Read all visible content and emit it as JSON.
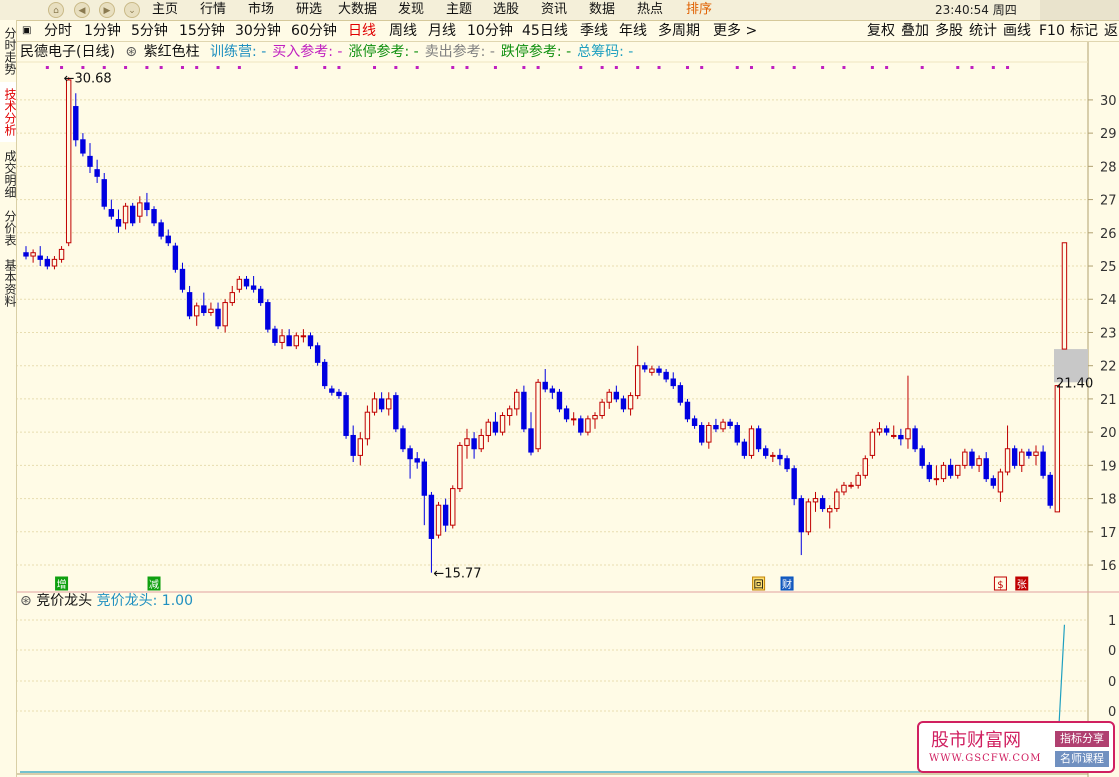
{
  "menu": [
    "主页",
    "行情",
    "市场",
    "研选",
    "大数据",
    "发现",
    "主题",
    "选股",
    "资讯",
    "数据",
    "热点",
    "排序"
  ],
  "menu_active": "排序",
  "clock": "23:40:54 周四",
  "periods": [
    "分时",
    "1分钟",
    "5分钟",
    "15分钟",
    "30分钟",
    "60分钟",
    "日线",
    "周线",
    "月线",
    "10分钟",
    "45日线",
    "季线",
    "年线",
    "多周期",
    "更多 >"
  ],
  "period_active": "日线",
  "right_tools": [
    "复权",
    "叠加",
    "多股",
    "统计",
    "画线",
    "F10",
    "标记",
    "返"
  ],
  "sidebar": [
    "分时走势",
    "技术分析",
    "成交明细",
    "分价表",
    "基本资料"
  ],
  "sidebar_active": "技术分析",
  "info": {
    "stock": "民德电子(日线)",
    "indicator": "紫红色柱",
    "items": [
      {
        "text": "训练营: -",
        "color": "#2090c0"
      },
      {
        "text": "买入参考: -",
        "color": "#c020c0"
      },
      {
        "text": "涨停参考: -",
        "color": "#109010"
      },
      {
        "text": "卖出参考: -",
        "color": "#808080"
      },
      {
        "text": "跌停参考: -",
        "color": "#109010"
      },
      {
        "text": "总筹码: -",
        "color": "#20a0c0"
      }
    ]
  },
  "subinfo": {
    "name": "竞价龙头",
    "label": "竞价龙头: 1.00",
    "color": "#2090c0"
  },
  "colors": {
    "up": "#c00000",
    "down": "#0000e0",
    "grid": "#e8ddb0",
    "axis": "#b0a070",
    "dots": "#c020c0",
    "subline": "#20a0c0"
  },
  "chart_data": {
    "type": "candlestick",
    "ylim": [
      15.7,
      30.9
    ],
    "yticks": [
      16,
      17,
      18,
      19,
      20,
      21,
      22,
      23,
      24,
      25,
      26,
      27,
      28,
      29,
      30
    ],
    "annotations": [
      {
        "text": "30.68",
        "value": 30.68,
        "index": 5
      },
      {
        "text": "15.77",
        "value": 15.77,
        "index": 57
      },
      {
        "text": "21.40",
        "value": 21.4,
        "index": 138
      }
    ],
    "candles": [
      [
        25.4,
        25.6,
        25.2,
        25.3
      ],
      [
        25.3,
        25.5,
        25.1,
        25.4
      ],
      [
        25.3,
        25.6,
        25.0,
        25.2
      ],
      [
        25.2,
        25.3,
        24.9,
        25.0
      ],
      [
        25.0,
        25.3,
        24.9,
        25.2
      ],
      [
        25.2,
        25.6,
        25.1,
        25.5
      ],
      [
        25.7,
        30.68,
        25.6,
        30.6
      ],
      [
        29.8,
        30.2,
        28.6,
        28.8
      ],
      [
        28.8,
        29.0,
        28.3,
        28.4
      ],
      [
        28.3,
        28.7,
        27.8,
        28.0
      ],
      [
        27.9,
        28.2,
        27.5,
        27.7
      ],
      [
        27.6,
        27.8,
        26.7,
        26.8
      ],
      [
        26.7,
        27.0,
        26.4,
        26.5
      ],
      [
        26.4,
        26.7,
        26.0,
        26.2
      ],
      [
        26.3,
        26.9,
        26.1,
        26.8
      ],
      [
        26.8,
        26.9,
        26.2,
        26.3
      ],
      [
        26.5,
        27.1,
        26.3,
        26.9
      ],
      [
        26.9,
        27.2,
        26.5,
        26.7
      ],
      [
        26.7,
        26.8,
        26.2,
        26.3
      ],
      [
        26.3,
        26.4,
        25.8,
        25.9
      ],
      [
        25.9,
        26.1,
        25.6,
        25.7
      ],
      [
        25.6,
        25.7,
        24.8,
        24.9
      ],
      [
        24.9,
        25.1,
        24.2,
        24.3
      ],
      [
        24.2,
        24.4,
        23.4,
        23.5
      ],
      [
        23.5,
        23.9,
        23.2,
        23.8
      ],
      [
        23.8,
        24.2,
        23.5,
        23.6
      ],
      [
        23.6,
        23.9,
        23.5,
        23.7
      ],
      [
        23.7,
        23.9,
        23.1,
        23.2
      ],
      [
        23.2,
        24.0,
        23.0,
        23.9
      ],
      [
        23.9,
        24.4,
        23.8,
        24.2
      ],
      [
        24.3,
        24.7,
        24.2,
        24.6
      ],
      [
        24.6,
        24.7,
        24.3,
        24.4
      ],
      [
        24.4,
        24.7,
        24.2,
        24.3
      ],
      [
        24.3,
        24.4,
        23.8,
        23.9
      ],
      [
        23.9,
        24.0,
        23.0,
        23.1
      ],
      [
        23.1,
        23.2,
        22.6,
        22.7
      ],
      [
        22.7,
        23.1,
        22.5,
        22.9
      ],
      [
        22.9,
        23.1,
        22.6,
        22.6
      ],
      [
        22.6,
        23.0,
        22.5,
        22.9
      ],
      [
        22.9,
        23.1,
        22.7,
        22.9
      ],
      [
        22.9,
        23.0,
        22.5,
        22.6
      ],
      [
        22.6,
        22.7,
        22.0,
        22.1
      ],
      [
        22.1,
        22.2,
        21.3,
        21.4
      ],
      [
        21.3,
        21.4,
        21.1,
        21.2
      ],
      [
        21.2,
        21.3,
        21.0,
        21.1
      ],
      [
        21.1,
        21.2,
        19.8,
        19.9
      ],
      [
        19.9,
        20.2,
        19.1,
        19.3
      ],
      [
        19.3,
        20.0,
        19.0,
        19.8
      ],
      [
        19.8,
        20.8,
        19.6,
        20.6
      ],
      [
        20.6,
        21.2,
        20.5,
        21.0
      ],
      [
        21.0,
        21.2,
        20.6,
        20.7
      ],
      [
        20.7,
        21.2,
        20.5,
        21.0
      ],
      [
        21.1,
        21.2,
        20.0,
        20.1
      ],
      [
        20.1,
        20.2,
        19.4,
        19.5
      ],
      [
        19.5,
        19.6,
        18.6,
        19.2
      ],
      [
        19.2,
        19.4,
        18.9,
        19.1
      ],
      [
        19.1,
        19.2,
        17.2,
        18.1
      ],
      [
        18.1,
        18.2,
        15.77,
        16.8
      ],
      [
        16.9,
        17.9,
        16.8,
        17.8
      ],
      [
        17.8,
        18.0,
        17.0,
        17.2
      ],
      [
        17.2,
        18.4,
        17.1,
        18.3
      ],
      [
        18.3,
        19.7,
        18.2,
        19.6
      ],
      [
        19.6,
        20.1,
        19.2,
        19.8
      ],
      [
        19.8,
        20.0,
        19.2,
        19.5
      ],
      [
        19.5,
        20.1,
        19.4,
        19.9
      ],
      [
        19.9,
        20.4,
        19.7,
        20.3
      ],
      [
        20.3,
        20.6,
        19.9,
        20.0
      ],
      [
        20.0,
        20.6,
        19.9,
        20.5
      ],
      [
        20.5,
        20.8,
        20.2,
        20.7
      ],
      [
        20.7,
        21.3,
        20.5,
        21.2
      ],
      [
        21.2,
        21.4,
        20.0,
        20.1
      ],
      [
        20.1,
        20.6,
        19.3,
        19.4
      ],
      [
        19.5,
        21.6,
        19.4,
        21.5
      ],
      [
        21.5,
        21.9,
        21.2,
        21.3
      ],
      [
        21.3,
        21.4,
        21.0,
        21.2
      ],
      [
        21.2,
        21.3,
        20.6,
        20.7
      ],
      [
        20.7,
        20.8,
        20.3,
        20.4
      ],
      [
        20.4,
        20.6,
        20.2,
        20.4
      ],
      [
        20.4,
        20.5,
        19.9,
        20.0
      ],
      [
        20.0,
        20.5,
        19.9,
        20.4
      ],
      [
        20.4,
        20.6,
        20.1,
        20.5
      ],
      [
        20.5,
        21.0,
        20.4,
        20.9
      ],
      [
        20.9,
        21.3,
        20.7,
        21.2
      ],
      [
        21.2,
        21.4,
        20.9,
        21.0
      ],
      [
        21.0,
        21.1,
        20.6,
        20.7
      ],
      [
        20.7,
        21.2,
        20.5,
        21.1
      ],
      [
        21.1,
        22.6,
        21.0,
        22.0
      ],
      [
        22.0,
        22.1,
        21.8,
        21.9
      ],
      [
        21.8,
        22.0,
        21.7,
        21.9
      ],
      [
        21.9,
        22.0,
        21.7,
        21.8
      ],
      [
        21.8,
        21.9,
        21.5,
        21.6
      ],
      [
        21.6,
        21.8,
        21.3,
        21.4
      ],
      [
        21.4,
        21.5,
        20.8,
        20.9
      ],
      [
        20.9,
        21.0,
        20.3,
        20.4
      ],
      [
        20.4,
        20.5,
        20.1,
        20.2
      ],
      [
        20.2,
        20.3,
        19.6,
        19.7
      ],
      [
        19.7,
        20.3,
        19.5,
        20.2
      ],
      [
        20.2,
        20.4,
        20.0,
        20.1
      ],
      [
        20.1,
        20.4,
        20.0,
        20.3
      ],
      [
        20.3,
        20.4,
        20.1,
        20.2
      ],
      [
        20.2,
        20.3,
        19.6,
        19.7
      ],
      [
        19.7,
        19.8,
        19.2,
        19.3
      ],
      [
        19.3,
        20.2,
        19.2,
        20.1
      ],
      [
        20.1,
        20.2,
        19.4,
        19.5
      ],
      [
        19.5,
        19.6,
        19.2,
        19.3
      ],
      [
        19.3,
        19.4,
        19.1,
        19.3
      ],
      [
        19.3,
        19.5,
        19.0,
        19.2
      ],
      [
        19.2,
        19.3,
        18.8,
        18.9
      ],
      [
        18.9,
        19.0,
        17.8,
        18.0
      ],
      [
        18.0,
        18.1,
        16.3,
        17.0
      ],
      [
        17.0,
        18.0,
        16.9,
        17.9
      ],
      [
        17.9,
        18.2,
        17.6,
        18.0
      ],
      [
        18.0,
        18.1,
        17.6,
        17.7
      ],
      [
        17.6,
        17.8,
        17.1,
        17.7
      ],
      [
        17.7,
        18.3,
        17.6,
        18.2
      ],
      [
        18.2,
        18.5,
        18.1,
        18.4
      ],
      [
        18.4,
        18.5,
        18.3,
        18.4
      ],
      [
        18.4,
        18.8,
        18.3,
        18.7
      ],
      [
        18.7,
        19.3,
        18.6,
        19.2
      ],
      [
        19.3,
        20.1,
        19.2,
        20.0
      ],
      [
        20.0,
        20.3,
        19.9,
        20.1
      ],
      [
        20.1,
        20.2,
        19.9,
        20.0
      ],
      [
        19.9,
        20.2,
        19.8,
        19.9
      ],
      [
        19.9,
        20.1,
        19.6,
        19.8
      ],
      [
        19.8,
        21.7,
        19.5,
        20.1
      ],
      [
        20.1,
        20.2,
        19.4,
        19.5
      ],
      [
        19.5,
        19.6,
        18.9,
        19.0
      ],
      [
        19.0,
        19.1,
        18.5,
        18.6
      ],
      [
        18.6,
        19.0,
        18.4,
        18.6
      ],
      [
        18.6,
        19.1,
        18.5,
        19.0
      ],
      [
        19.0,
        19.2,
        18.6,
        18.7
      ],
      [
        18.7,
        19.0,
        18.6,
        19.0
      ],
      [
        19.0,
        19.5,
        18.9,
        19.4
      ],
      [
        19.4,
        19.5,
        18.9,
        19.0
      ],
      [
        19.0,
        19.3,
        18.8,
        19.2
      ],
      [
        19.2,
        19.4,
        18.5,
        18.6
      ],
      [
        18.6,
        18.7,
        18.3,
        18.4
      ],
      [
        18.2,
        18.9,
        17.9,
        18.8
      ],
      [
        18.8,
        20.2,
        18.7,
        19.5
      ],
      [
        19.5,
        19.6,
        18.9,
        19.0
      ],
      [
        19.0,
        19.5,
        18.8,
        19.4
      ],
      [
        19.4,
        19.5,
        19.2,
        19.3
      ],
      [
        19.3,
        19.6,
        19.0,
        19.4
      ],
      [
        19.4,
        19.6,
        18.6,
        18.7
      ],
      [
        18.7,
        18.8,
        17.7,
        17.8
      ],
      [
        17.6,
        21.4,
        17.6,
        21.4
      ]
    ],
    "last_bar": {
      "open": 22.5,
      "high": 25.7,
      "low": 22.5,
      "close": 25.7
    },
    "highlight_zone": {
      "from": 21.5,
      "to": 22.5
    },
    "markers": [
      {
        "text": "增",
        "color": "#10a010",
        "bg": "#10a010",
        "fg": "#ffffff",
        "index": 5
      },
      {
        "text": "减",
        "color": "#10a010",
        "bg": "#10a010",
        "fg": "#ffffff",
        "index": 18
      },
      {
        "text": "回",
        "color": "#c08000",
        "bg": "#ffe070",
        "fg": "#000000",
        "index": 103
      },
      {
        "text": "财",
        "color": "#0050c0",
        "bg": "#2060c0",
        "fg": "#ffffff",
        "index": 107
      },
      {
        "text": "$",
        "color": "#c00000",
        "bg": "#fffbe6",
        "fg": "#c00000",
        "index": 137
      },
      {
        "text": "张",
        "color": "#c00000",
        "bg": "#c00000",
        "fg": "#ffffff",
        "index": 140
      }
    ],
    "dot_columns": [
      3,
      5,
      8,
      11,
      14,
      17,
      19,
      22,
      24,
      27,
      30,
      38,
      42,
      44,
      49,
      52,
      55,
      60,
      62,
      66,
      70,
      72,
      78,
      81,
      83,
      86,
      89,
      93,
      95,
      100,
      102,
      105,
      108,
      112,
      115,
      119,
      121,
      126,
      131,
      133,
      136,
      138
    ],
    "sub_ylim": [
      0,
      1.1
    ],
    "sub_yticks_labels": [
      "1",
      "0",
      "0",
      "0"
    ],
    "sub_series": {
      "name": "竞价龙头",
      "last_value": 1.0
    }
  },
  "watermark": {
    "main": "股市财富网",
    "url": "WWW.GSCFW.COM",
    "tag1": "指标分享",
    "tag2": "名师课程"
  }
}
